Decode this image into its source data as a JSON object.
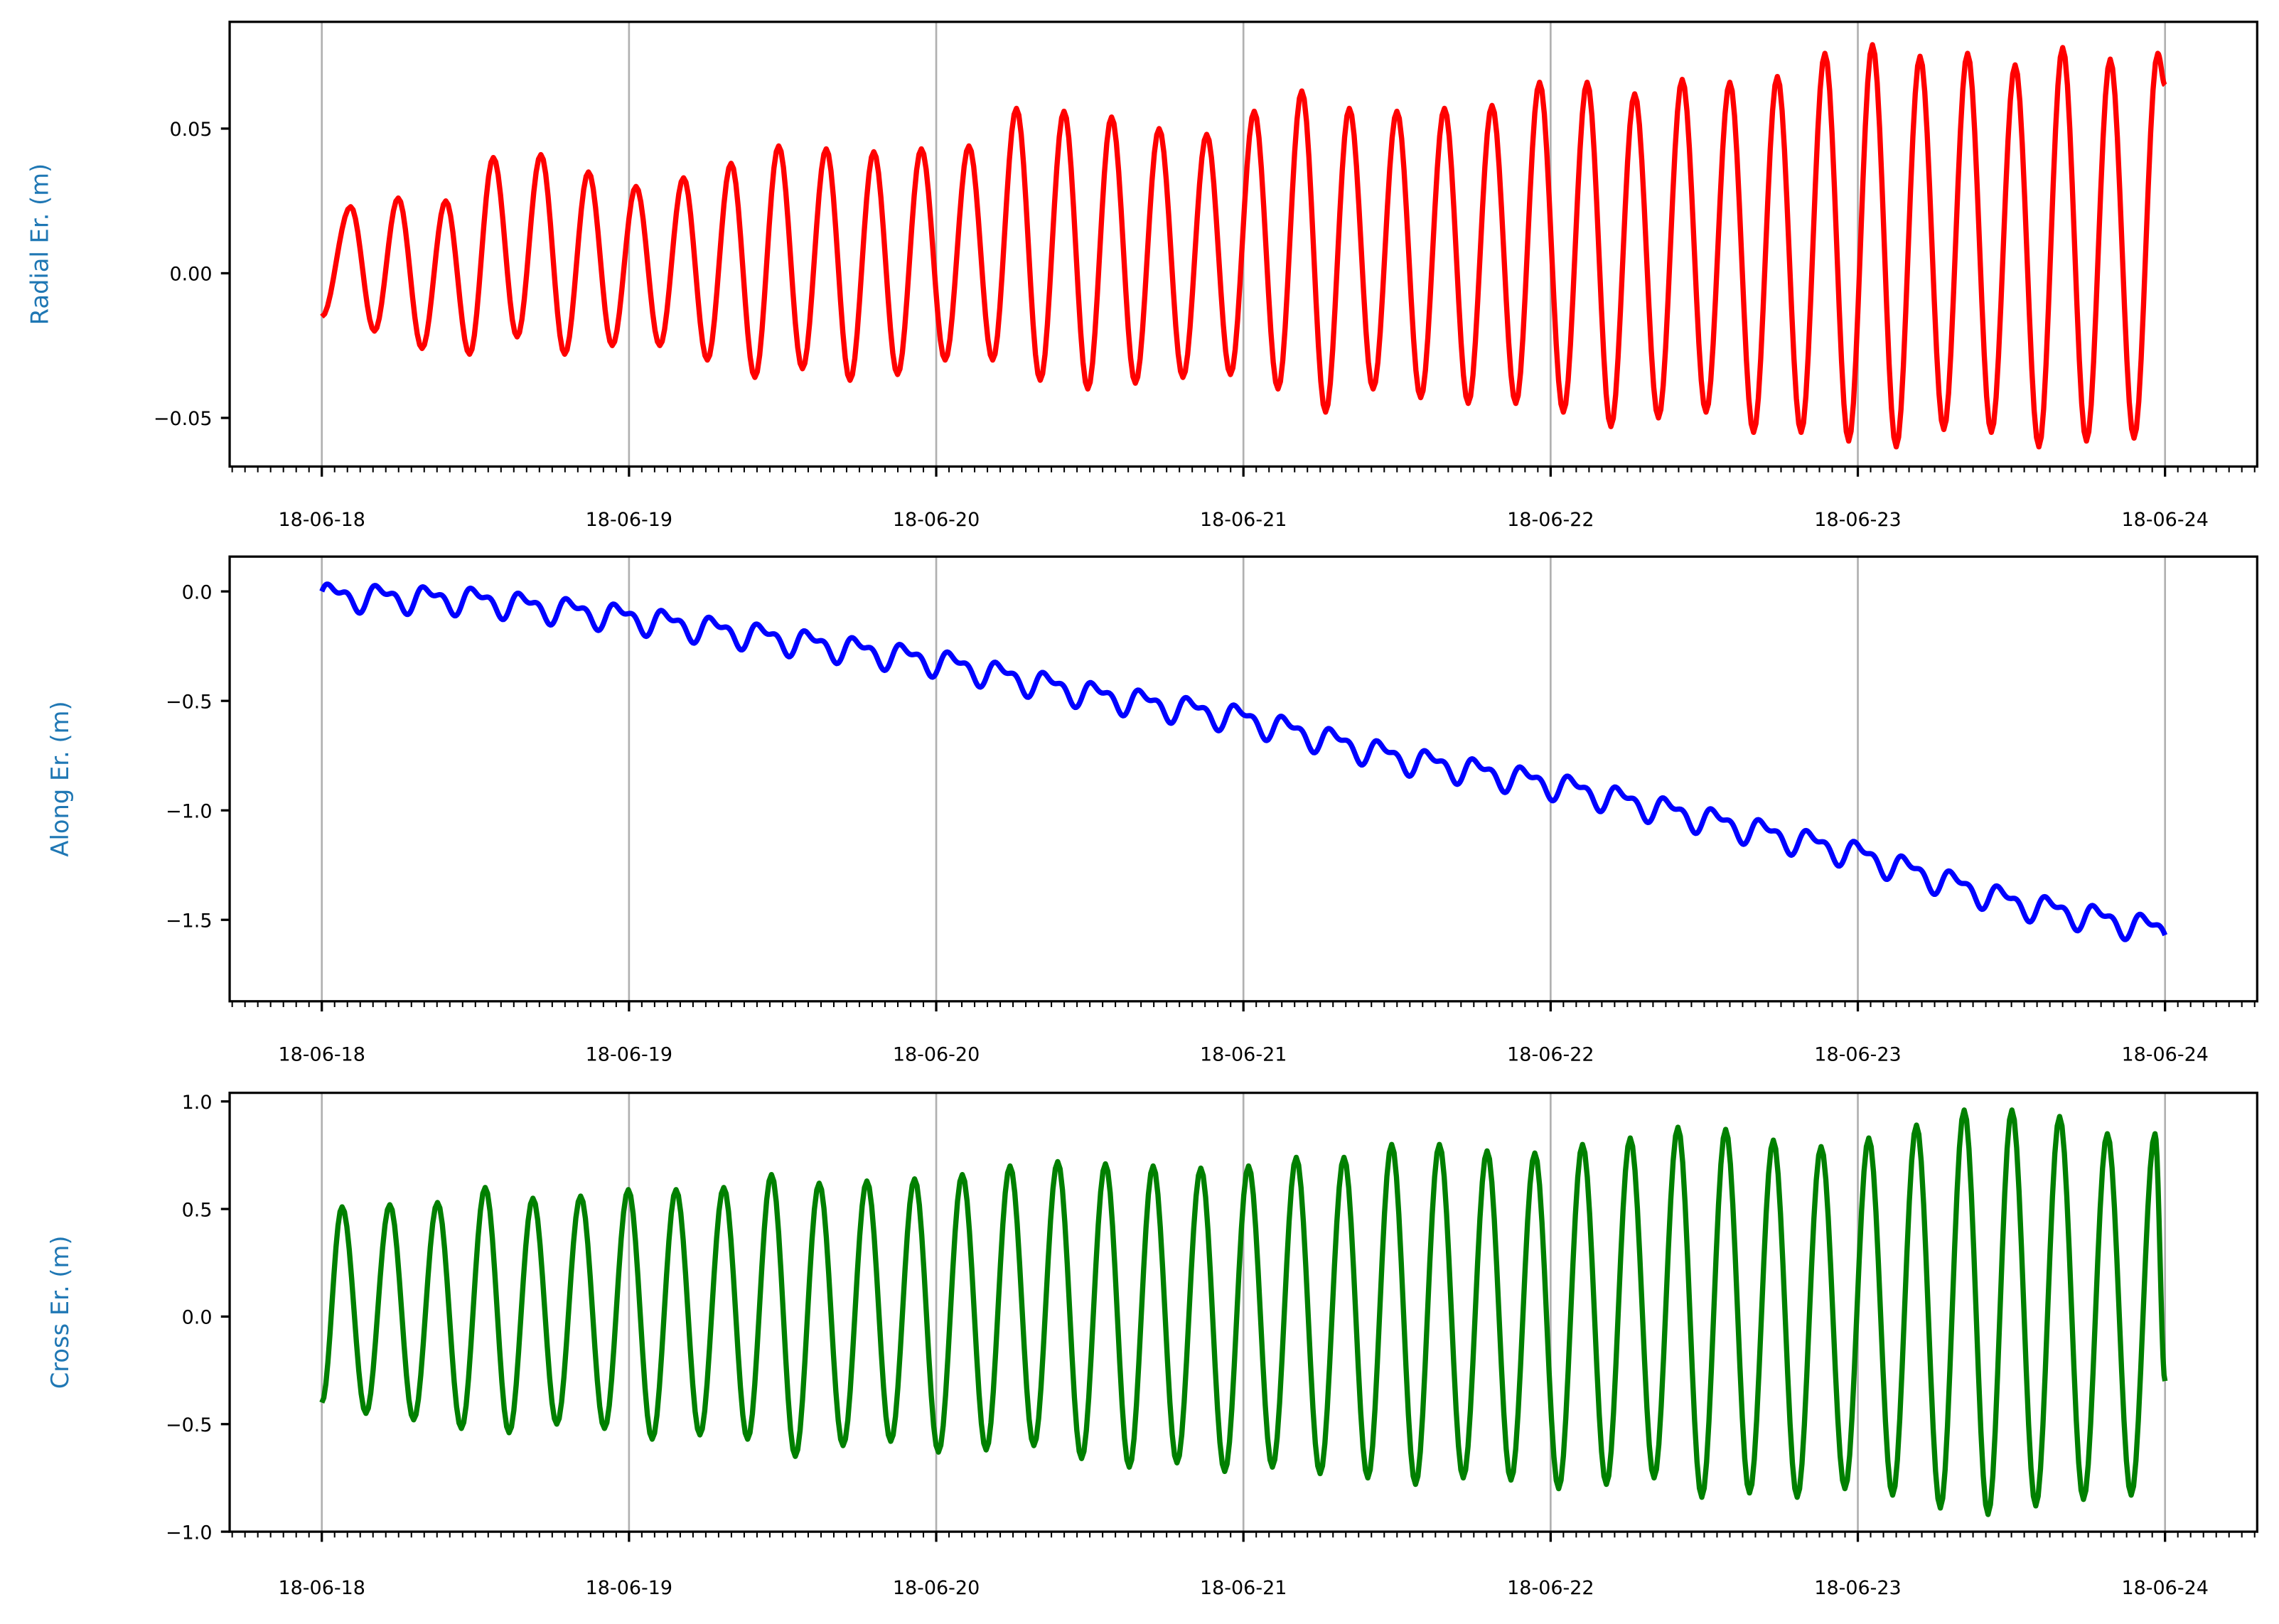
{
  "chart_data": [
    {
      "type": "line",
      "ylabel": "Radial Er. (m)",
      "color": "#ff0000",
      "xlim_days": [
        -0.3,
        6.3
      ],
      "ylim": [
        -0.0668,
        0.0869
      ],
      "x_ticks": [
        "18-06-18",
        "18-06-19",
        "18-06-20",
        "18-06-21",
        "18-06-22",
        "18-06-23",
        "18-06-24"
      ],
      "y_ticks": [
        {
          "v": 0.05,
          "label": "0.05"
        },
        {
          "v": 0.0,
          "label": "0.00"
        },
        {
          "v": -0.05,
          "label": "−0.05"
        }
      ],
      "grid": "x-major",
      "start_value": -0.015,
      "end_value": 0.065,
      "period_days": 0.1548,
      "first_peak_day": 0.094,
      "peaks": [
        0.023,
        0.026,
        0.025,
        0.04,
        0.041,
        0.035,
        0.03,
        0.033,
        0.038,
        0.044,
        0.043,
        0.042,
        0.043,
        0.044,
        0.057,
        0.056,
        0.054,
        0.05,
        0.048,
        0.056,
        0.063,
        0.057,
        0.056,
        0.057,
        0.058,
        0.066,
        0.066,
        0.062,
        0.067,
        0.066,
        0.068,
        0.076,
        0.079,
        0.075,
        0.076,
        0.072,
        0.078,
        0.074,
        0.076
      ],
      "troughs": [
        -0.02,
        -0.026,
        -0.028,
        -0.022,
        -0.028,
        -0.025,
        -0.025,
        -0.03,
        -0.036,
        -0.033,
        -0.037,
        -0.035,
        -0.03,
        -0.03,
        -0.037,
        -0.04,
        -0.038,
        -0.036,
        -0.035,
        -0.04,
        -0.048,
        -0.04,
        -0.043,
        -0.045,
        -0.045,
        -0.048,
        -0.053,
        -0.05,
        -0.048,
        -0.055,
        -0.055,
        -0.058,
        -0.06,
        -0.054,
        -0.055,
        -0.06,
        -0.058,
        -0.057,
        -0.056
      ]
    },
    {
      "type": "line",
      "ylabel": "Along Er. (m)",
      "color": "#0000ff",
      "xlim_days": [
        -0.3,
        6.3
      ],
      "ylim": [
        -1.872,
        0.159
      ],
      "x_ticks": [
        "18-06-18",
        "18-06-19",
        "18-06-20",
        "18-06-21",
        "18-06-22",
        "18-06-23",
        "18-06-24"
      ],
      "y_ticks": [
        {
          "v": 0.0,
          "label": "0.0"
        },
        {
          "v": -0.5,
          "label": "−0.5"
        },
        {
          "v": -1.0,
          "label": "−1.0"
        },
        {
          "v": -1.5,
          "label": "−1.5"
        }
      ],
      "grid": "x-major",
      "trend_days": [
        0,
        0.5,
        1,
        1.5,
        2,
        2.5,
        3,
        3.5,
        4,
        4.5,
        5,
        5.5,
        6
      ],
      "trend_values": [
        -0.02,
        -0.04,
        -0.12,
        -0.22,
        -0.32,
        -0.47,
        -0.58,
        -0.76,
        -0.88,
        -1.04,
        -1.2,
        -1.42,
        -1.55
      ],
      "oscillation_amplitude": 0.07,
      "period_days": 0.1553
    },
    {
      "type": "line",
      "ylabel": "Cross Er. (m)",
      "color": "#008000",
      "xlim_days": [
        -0.3,
        6.3
      ],
      "ylim": [
        -1.0,
        1.04
      ],
      "x_ticks": [
        "18-06-18",
        "18-06-19",
        "18-06-20",
        "18-06-21",
        "18-06-22",
        "18-06-23",
        "18-06-24"
      ],
      "y_ticks": [
        {
          "v": 1.0,
          "label": "1.0"
        },
        {
          "v": 0.5,
          "label": "0.5"
        },
        {
          "v": 0.0,
          "label": "0.0"
        },
        {
          "v": -0.5,
          "label": "−0.5"
        },
        {
          "v": -1.0,
          "label": "−1.0"
        }
      ],
      "grid": "x-major",
      "start_value": -0.4,
      "end_value": -0.3,
      "period_days": 0.1553,
      "first_peak_day": 0.066,
      "peaks": [
        0.51,
        0.52,
        0.53,
        0.6,
        0.55,
        0.56,
        0.59,
        0.59,
        0.6,
        0.66,
        0.62,
        0.63,
        0.64,
        0.66,
        0.7,
        0.72,
        0.71,
        0.7,
        0.69,
        0.7,
        0.74,
        0.74,
        0.8,
        0.8,
        0.77,
        0.76,
        0.8,
        0.83,
        0.88,
        0.87,
        0.82,
        0.79,
        0.83,
        0.89,
        0.96,
        0.96,
        0.93,
        0.85,
        0.85
      ],
      "troughs": [
        -0.45,
        -0.48,
        -0.52,
        -0.54,
        -0.5,
        -0.52,
        -0.57,
        -0.55,
        -0.57,
        -0.65,
        -0.6,
        -0.58,
        -0.63,
        -0.62,
        -0.6,
        -0.66,
        -0.7,
        -0.68,
        -0.72,
        -0.7,
        -0.73,
        -0.75,
        -0.78,
        -0.75,
        -0.76,
        -0.8,
        -0.78,
        -0.75,
        -0.84,
        -0.82,
        -0.84,
        -0.8,
        -0.83,
        -0.89,
        -0.92,
        -0.88,
        -0.85,
        -0.83,
        -0.8
      ]
    }
  ]
}
